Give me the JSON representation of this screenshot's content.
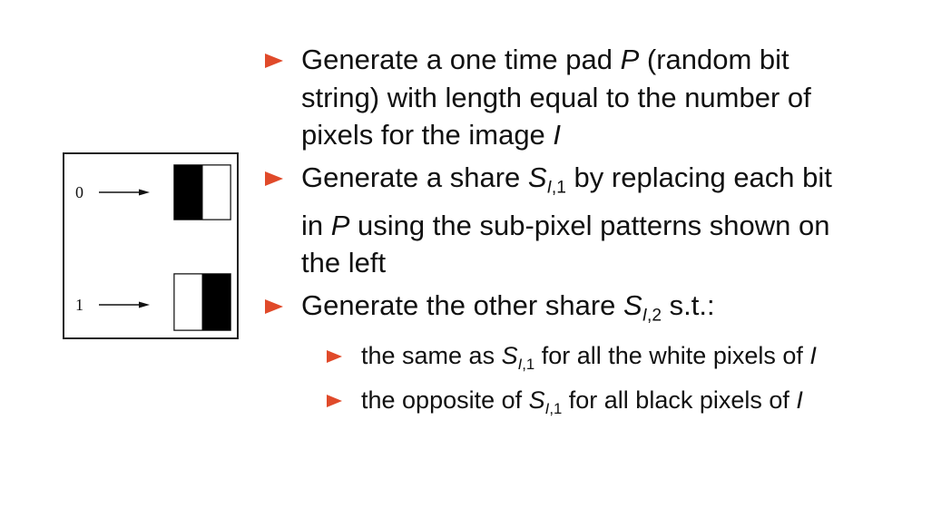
{
  "diagram": {
    "label_zero": "0",
    "label_one": "1",
    "pattern_zero": "black-white",
    "pattern_one": "white-black",
    "colors": {
      "black": "#000000",
      "white": "#ffffff",
      "stroke": "#222222"
    }
  },
  "bullets": [
    {
      "parts": {
        "a": "Generate a one time pad ",
        "b": "P",
        "c": " (random bit string) with length equal to the number of pixels for the image ",
        "d": "I"
      }
    },
    {
      "parts": {
        "a": "Generate a share ",
        "b": "S",
        "sub_var": "I",
        "sub_rest": ",1",
        "c": " by replacing each bit in ",
        "d": "P",
        "e": " using the sub-pixel patterns shown on the left"
      }
    },
    {
      "parts": {
        "a": "Generate the other share ",
        "b": "S",
        "sub_var": "I",
        "sub_rest": ",2",
        "c": " s.t.:"
      },
      "sub_bullets": [
        {
          "a": "the same as ",
          "b": "S",
          "sub_var": "I",
          "sub_rest": ",1",
          "c": " for all the white pixels of ",
          "d": "I"
        },
        {
          "a": "the opposite of ",
          "b": "S",
          "sub_var": "I",
          "sub_rest": ",1",
          "c": " for all black pixels of ",
          "d": "I"
        }
      ]
    }
  ],
  "theme": {
    "bullet_color": "#e04a2a",
    "text_color": "#111111"
  }
}
